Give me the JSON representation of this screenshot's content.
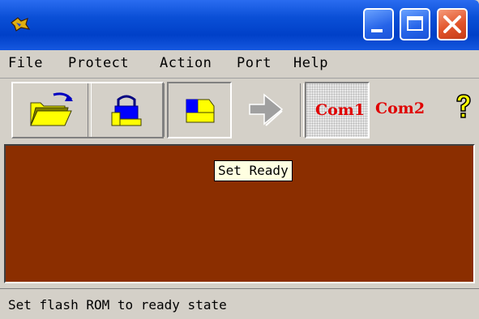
{
  "window": {
    "title": "",
    "controls": [
      "minimize",
      "maximize",
      "close"
    ]
  },
  "menu": {
    "items": [
      "File",
      "Protect",
      "Action",
      "Port",
      "Help"
    ]
  },
  "toolbar": {
    "buttons": [
      {
        "name": "open",
        "icon": "open-folder-icon"
      },
      {
        "name": "protect",
        "icon": "lock-icon"
      },
      {
        "name": "set-ready",
        "icon": "ready-chip-icon",
        "pressed": true
      },
      {
        "name": "action",
        "icon": "arrow-icon",
        "disabled": true
      }
    ],
    "com1_label": "Com1",
    "com2_label": "Com2",
    "help_icon": "question-mark-icon"
  },
  "tooltip": {
    "text": "Set Ready"
  },
  "status": {
    "text": "Set flash ROM to ready state"
  },
  "colors": {
    "title_bar": "#0a4fd6",
    "main_area": "#8b2e00",
    "com_label": "#e00000",
    "tooltip_bg": "#ffffe1"
  }
}
